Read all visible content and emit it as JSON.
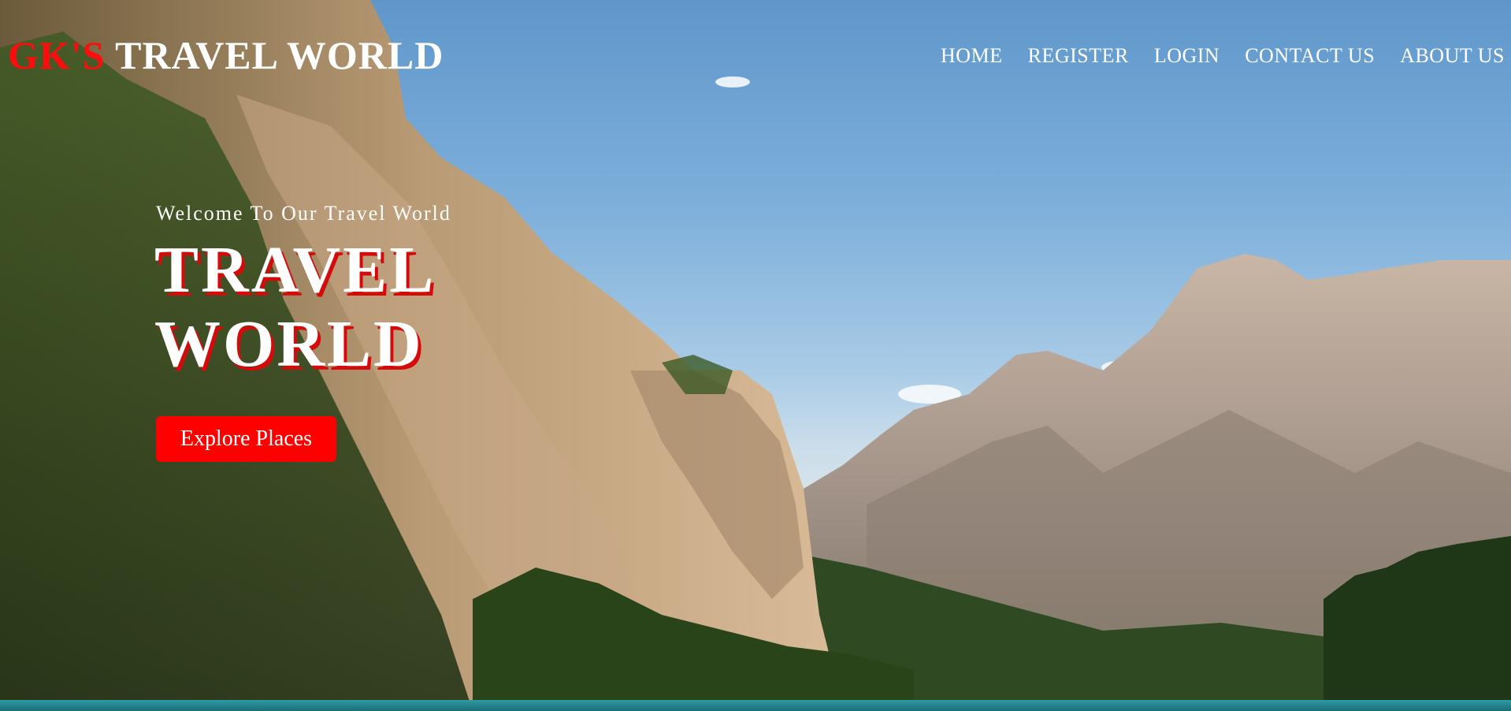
{
  "header": {
    "logo_accent": "GK'S",
    "logo_rest": " TRAVEL WORLD"
  },
  "nav": {
    "items": [
      {
        "label": "HOME"
      },
      {
        "label": "REGISTER"
      },
      {
        "label": "LOGIN"
      },
      {
        "label": "CONTACT US"
      },
      {
        "label": "ABOUT US"
      }
    ]
  },
  "hero": {
    "welcome": "Welcome To Our Travel World",
    "title_line1": "TRAVEL",
    "title_line2": "WORLD",
    "cta_label": "Explore Places",
    "background": "mountain-lake-landscape"
  },
  "colors": {
    "accent": "#ff0000",
    "text": "#ffffff"
  }
}
